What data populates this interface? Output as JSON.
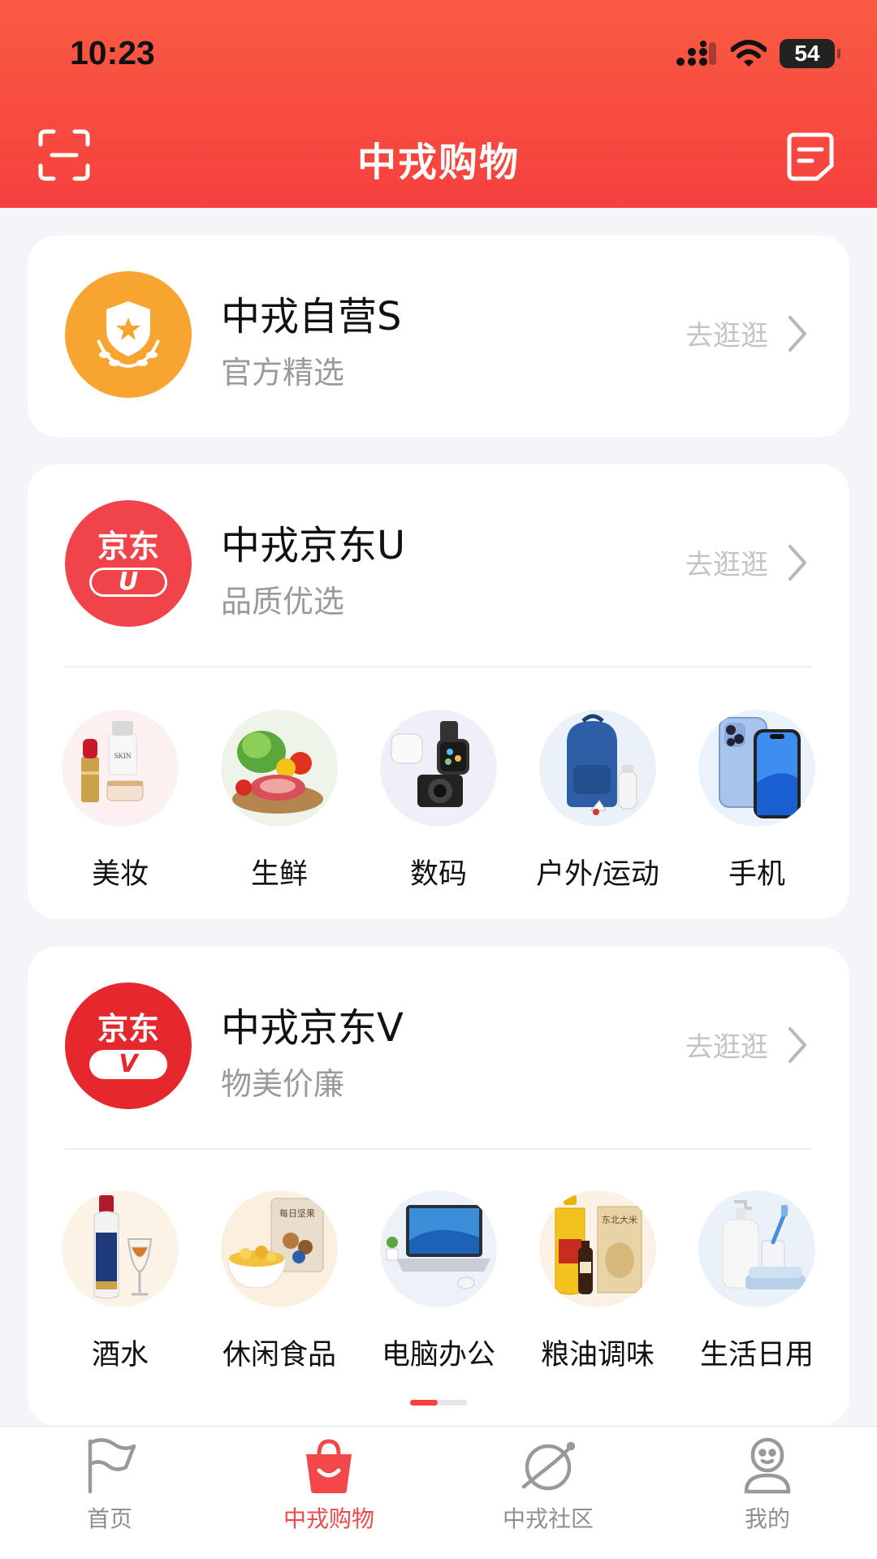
{
  "status_bar": {
    "time": "10:23",
    "battery": "54"
  },
  "header": {
    "title": "中戎购物"
  },
  "go_label": "去逛逛",
  "stores": [
    {
      "name": "中戎自营S",
      "subtitle": "官方精选"
    },
    {
      "name": "中戎京东U",
      "subtitle": "品质优选",
      "logo_text": "京东",
      "badge": "U",
      "categories": [
        "美妆",
        "生鲜",
        "数码",
        "户外/运动",
        "手机"
      ]
    },
    {
      "name": "中戎京东V",
      "subtitle": "物美价廉",
      "logo_text": "京东",
      "badge": "V",
      "categories": [
        "酒水",
        "休闲食品",
        "电脑办公",
        "粮油调味",
        "生活日用"
      ]
    }
  ],
  "product_text": {
    "skin": "SKIN",
    "nuts": "每日坚果",
    "rice": "东北大米"
  },
  "tabbar": [
    {
      "label": "首页",
      "icon": "flag-icon"
    },
    {
      "label": "中戎购物",
      "icon": "shopping-bag-icon"
    },
    {
      "label": "中戎社区",
      "icon": "planet-icon"
    },
    {
      "label": "我的",
      "icon": "profile-icon"
    }
  ],
  "colors": {
    "brand": "#f5403e",
    "tab_active": "#f4474a",
    "self_logo": "#f8a431"
  }
}
